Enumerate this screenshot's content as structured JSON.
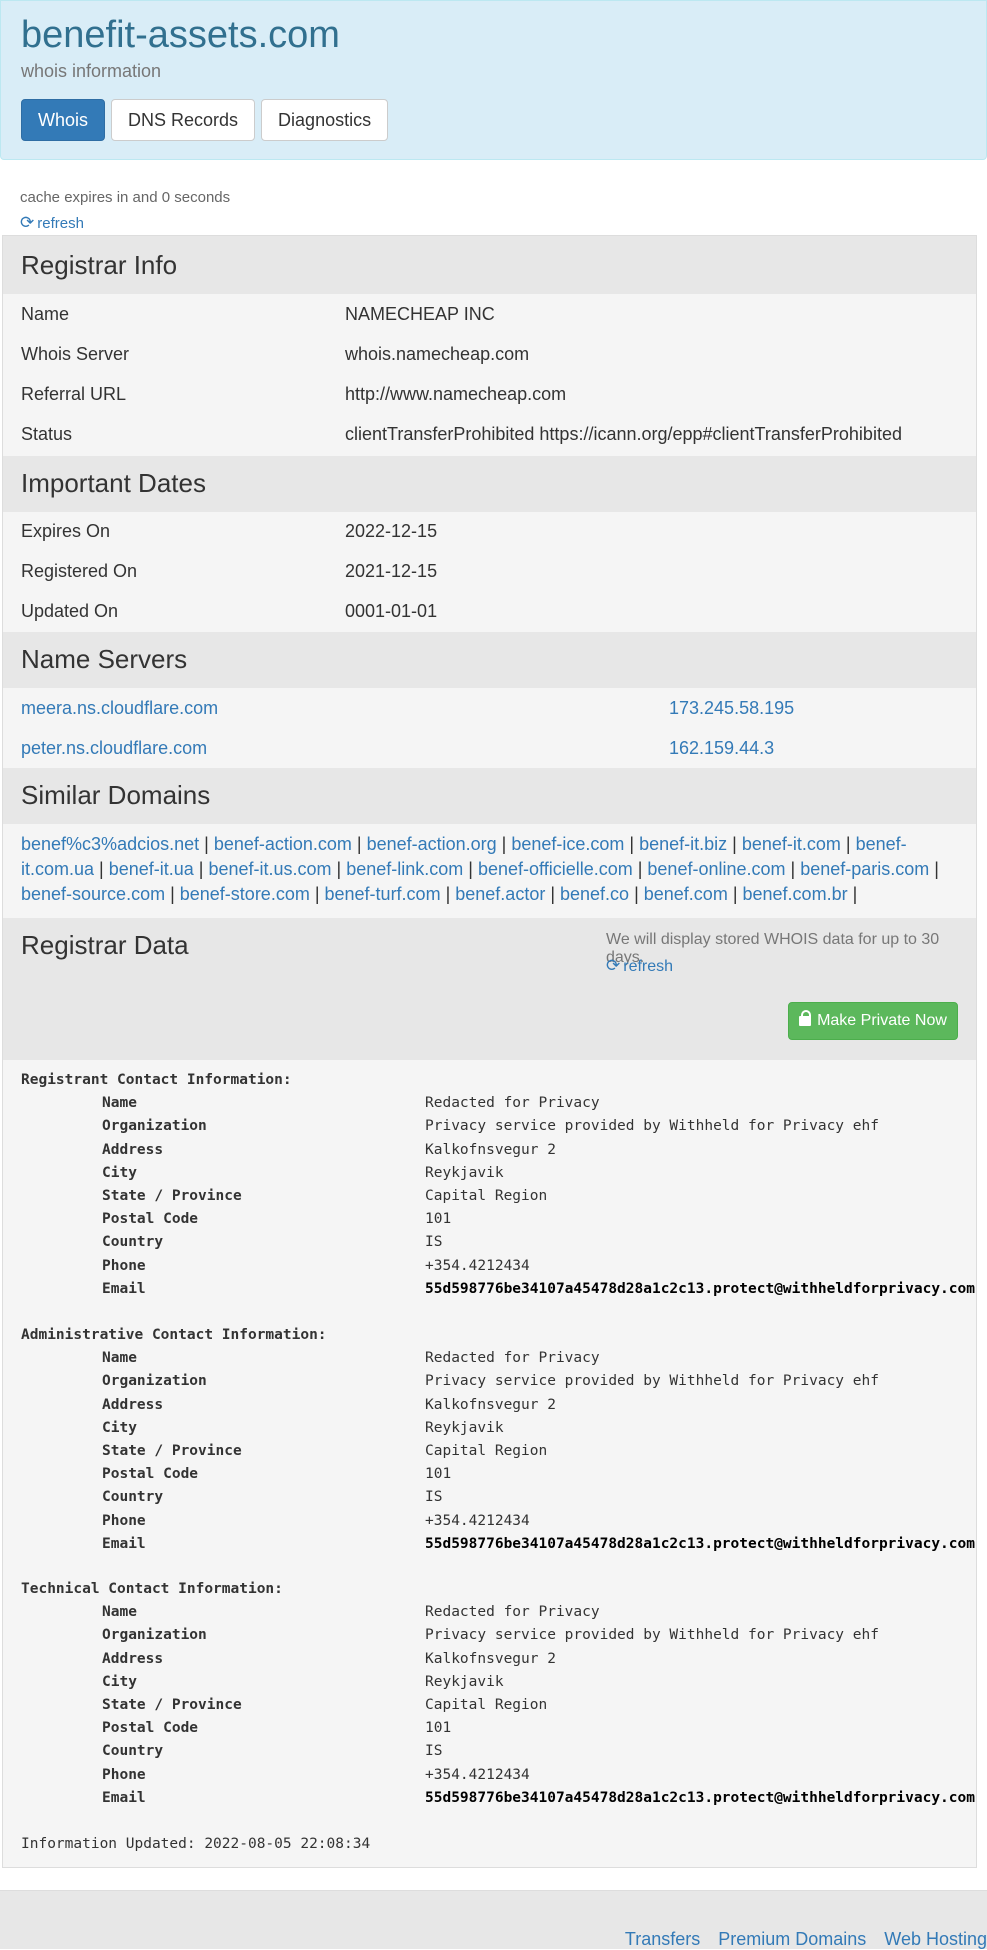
{
  "header": {
    "domain": "benefit-assets.com",
    "subtitle": "whois information",
    "tabs": [
      "Whois",
      "DNS Records",
      "Diagnostics"
    ]
  },
  "cache": {
    "text": "cache expires in and 0 seconds",
    "refresh_label": "refresh"
  },
  "registrar_info": {
    "title": "Registrar Info",
    "rows": [
      {
        "label": "Name",
        "value": "NAMECHEAP INC"
      },
      {
        "label": "Whois Server",
        "value": "whois.namecheap.com"
      },
      {
        "label": "Referral URL",
        "value": "http://www.namecheap.com"
      },
      {
        "label": "Status",
        "value": "clientTransferProhibited https://icann.org/epp#clientTransferProhibited"
      }
    ]
  },
  "important_dates": {
    "title": "Important Dates",
    "rows": [
      {
        "label": "Expires On",
        "value": "2022-12-15"
      },
      {
        "label": "Registered On",
        "value": "2021-12-15"
      },
      {
        "label": "Updated On",
        "value": "0001-01-01"
      }
    ]
  },
  "name_servers": {
    "title": "Name Servers",
    "rows": [
      {
        "host": "meera.ns.cloudflare.com",
        "ip": "173.245.58.195"
      },
      {
        "host": "peter.ns.cloudflare.com",
        "ip": "162.159.44.3"
      }
    ]
  },
  "similar_domains": {
    "title": "Similar Domains",
    "items": [
      "benef%c3%adcios.net",
      "benef-action.com",
      "benef-action.org",
      "benef-ice.com",
      "benef-it.biz",
      "benef-it.com",
      "benef-it.com.ua",
      "benef-it.ua",
      "benef-it.us.com",
      "benef-link.com",
      "benef-officielle.com",
      "benef-online.com",
      "benef-paris.com",
      "benef-source.com",
      "benef-store.com",
      "benef-turf.com",
      "benef.actor",
      "benef.co",
      "benef.com",
      "benef.com.br"
    ],
    "separator": " | "
  },
  "registrar_data": {
    "title": "Registrar Data",
    "retention_note": "We will display stored WHOIS data for up to 30 days.",
    "refresh_label": "refresh",
    "private_button": "Make Private Now",
    "sections": [
      {
        "heading": "Registrant Contact Information:",
        "fields": [
          {
            "label": "Name",
            "value": "Redacted for Privacy"
          },
          {
            "label": "Organization",
            "value": "Privacy service provided by Withheld for Privacy ehf"
          },
          {
            "label": "Address",
            "value": "Kalkofnsvegur 2"
          },
          {
            "label": "City",
            "value": "Reykjavik"
          },
          {
            "label": "State / Province",
            "value": "Capital Region"
          },
          {
            "label": "Postal Code",
            "value": "101"
          },
          {
            "label": "Country",
            "value": "IS"
          },
          {
            "label": "Phone",
            "value": "+354.4212434"
          },
          {
            "label": "Email",
            "value": "55d598776be34107a45478d28a1c2c13.protect@withheldforprivacy.com"
          }
        ]
      },
      {
        "heading": "Administrative Contact Information:",
        "fields": [
          {
            "label": "Name",
            "value": "Redacted for Privacy"
          },
          {
            "label": "Organization",
            "value": "Privacy service provided by Withheld for Privacy ehf"
          },
          {
            "label": "Address",
            "value": "Kalkofnsvegur 2"
          },
          {
            "label": "City",
            "value": "Reykjavik"
          },
          {
            "label": "State / Province",
            "value": "Capital Region"
          },
          {
            "label": "Postal Code",
            "value": "101"
          },
          {
            "label": "Country",
            "value": "IS"
          },
          {
            "label": "Phone",
            "value": "+354.4212434"
          },
          {
            "label": "Email",
            "value": "55d598776be34107a45478d28a1c2c13.protect@withheldforprivacy.com"
          }
        ]
      },
      {
        "heading": "Technical Contact Information:",
        "fields": [
          {
            "label": "Name",
            "value": "Redacted for Privacy"
          },
          {
            "label": "Organization",
            "value": "Privacy service provided by Withheld for Privacy ehf"
          },
          {
            "label": "Address",
            "value": "Kalkofnsvegur 2"
          },
          {
            "label": "City",
            "value": "Reykjavik"
          },
          {
            "label": "State / Province",
            "value": "Capital Region"
          },
          {
            "label": "Postal Code",
            "value": "101"
          },
          {
            "label": "Country",
            "value": "IS"
          },
          {
            "label": "Phone",
            "value": "+354.4212434"
          },
          {
            "label": "Email",
            "value": "55d598776be34107a45478d28a1c2c13.protect@withheldforprivacy.com"
          }
        ]
      }
    ],
    "updated": "Information Updated: 2022-08-05 22:08:34"
  },
  "footer": {
    "links": [
      "Transfers",
      "Premium Domains",
      "Web Hosting"
    ]
  },
  "colors": {
    "accent": "#337ab7",
    "header_bg": "#d9edf7",
    "success": "#5cb85c",
    "panel": "#f5f5f5",
    "section": "#e7e7e7"
  }
}
